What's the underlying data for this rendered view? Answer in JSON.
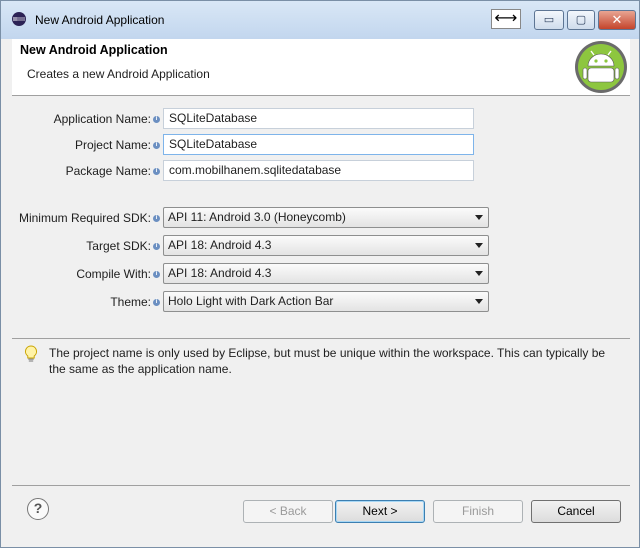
{
  "window": {
    "title": "New Android Application",
    "resize_glyph": "⟷",
    "minimize_glyph": "▭",
    "maximize_glyph": "▢",
    "close_glyph": "✕"
  },
  "header": {
    "title": "New Android Application",
    "subtitle": "Creates a new Android Application"
  },
  "form": {
    "app_name": {
      "label": "Application Name:",
      "value": "SQLiteDatabase"
    },
    "project_name": {
      "label": "Project Name:",
      "value": "SQLiteDatabase"
    },
    "package_name": {
      "label": "Package Name:",
      "value": "com.mobilhanem.sqlitedatabase"
    },
    "min_sdk": {
      "label": "Minimum Required SDK:",
      "value": "API 11: Android 3.0 (Honeycomb)"
    },
    "target_sdk": {
      "label": "Target SDK:",
      "value": "API 18: Android 4.3"
    },
    "compile_with": {
      "label": "Compile With:",
      "value": "API 18: Android 4.3"
    },
    "theme": {
      "label": "Theme:",
      "value": "Holo Light with Dark Action Bar"
    }
  },
  "hint": {
    "text": "The project name is only used by Eclipse, but must be unique within the workspace. This can typically be the same as the application name."
  },
  "buttons": {
    "help": "?",
    "back": "< Back",
    "next": "Next >",
    "finish": "Finish",
    "cancel": "Cancel"
  },
  "colors": {
    "android_green": "#9ac33c",
    "info_icon": "#6b8fc1",
    "hint_bulb": "#f5d547"
  }
}
